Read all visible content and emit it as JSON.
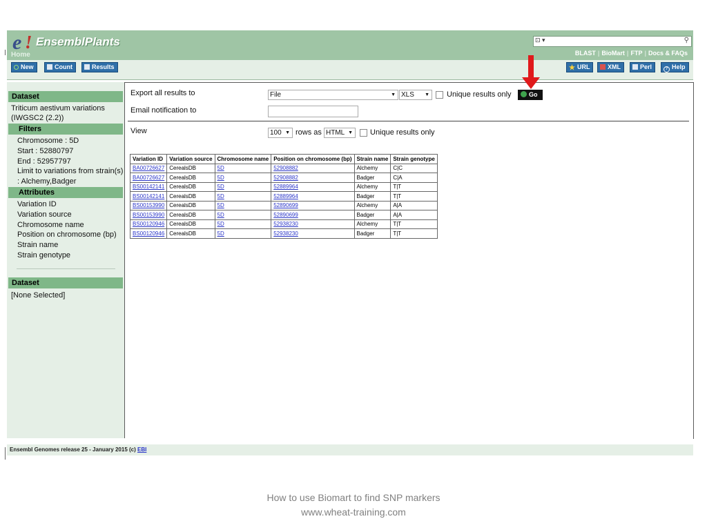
{
  "header": {
    "logo_e": "e",
    "logo_bang": "!",
    "logo_text": "EnsemblPlants",
    "home": "Home",
    "search_type": "⊡ ▾",
    "search_icon": "search-icon",
    "links": [
      "BLAST",
      "BioMart",
      "FTP",
      "Docs & FAQs"
    ]
  },
  "toolbar": {
    "new": "New",
    "count": "Count",
    "results": "Results",
    "url": "URL",
    "xml": "XML",
    "perl": "Perl",
    "help": "Help"
  },
  "sidebar": {
    "dataset_head": "Dataset",
    "dataset_line1": "Triticum aestivum variations",
    "dataset_line2": "(IWGSC2 (2.2))",
    "filters_head": "Filters",
    "filters": [
      "Chromosome : 5D",
      "Start : 52880797",
      "End : 52957797",
      "Limit to variations from strain(s)",
      ": Alchemy,Badger"
    ],
    "attributes_head": "Attributes",
    "attributes": [
      "Variation ID",
      "Variation source",
      "Chromosome name",
      "Position on chromosome (bp)",
      "Strain name",
      "Strain genotype"
    ],
    "dataset2_head": "Dataset",
    "dataset2_value": "[None Selected]"
  },
  "export": {
    "label": "Export  all results to",
    "destination": "File",
    "format": "XLS",
    "unique_label": "Unique results only",
    "go": "Go",
    "email_label": "Email notification to",
    "email_value": ""
  },
  "view": {
    "label": "View",
    "rows": "100",
    "rows_label": "rows as",
    "format": "HTML",
    "unique_label": "Unique results only"
  },
  "table": {
    "headers": [
      "Variation ID",
      "Variation source",
      "Chromosome name",
      "Position on chromosome (bp)",
      "Strain name",
      "Strain genotype"
    ],
    "rows": [
      [
        "BA00726627",
        "CerealsDB",
        "5D",
        "52908882",
        "Alchemy",
        "C|C"
      ],
      [
        "BA00726627",
        "CerealsDB",
        "5D",
        "52908882",
        "Badger",
        "C|A"
      ],
      [
        "BS00142141",
        "CerealsDB",
        "5D",
        "52889964",
        "Alchemy",
        "T|T"
      ],
      [
        "BS00142141",
        "CerealsDB",
        "5D",
        "52889964",
        "Badger",
        "T|T"
      ],
      [
        "BS00153990",
        "CerealsDB",
        "5D",
        "52890699",
        "Alchemy",
        "A|A"
      ],
      [
        "BS00153990",
        "CerealsDB",
        "5D",
        "52890699",
        "Badger",
        "A|A"
      ],
      [
        "BS00120946",
        "CerealsDB",
        "5D",
        "52938230",
        "Alchemy",
        "T|T"
      ],
      [
        "BS00120946",
        "CerealsDB",
        "5D",
        "52938230",
        "Badger",
        "T|T"
      ]
    ]
  },
  "footer": {
    "text": "Ensembl Genomes release 25 - January 2015 (c) ",
    "link": "EBI"
  },
  "caption": {
    "line1": "How to use Biomart to find SNP markers",
    "line2": "www.wheat-training.com"
  },
  "colors": {
    "header_green": "#9fc5a5",
    "panel_bg": "#e5efe6",
    "section_green": "#7fb788",
    "button_blue": "#2f6fa8",
    "link_blue": "#2a35c8",
    "arrow_red": "#e0191b"
  }
}
